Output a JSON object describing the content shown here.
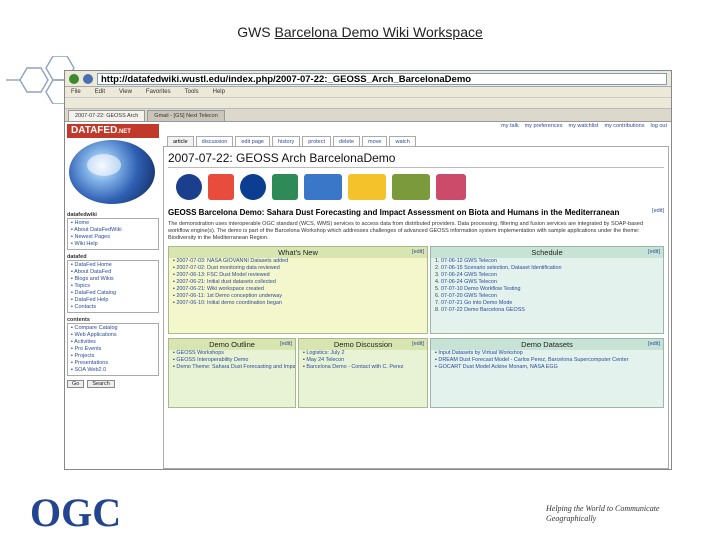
{
  "slide": {
    "title_prefix": "GWS ",
    "title_link": "Barcelona Demo Wiki Workspace",
    "footer_tag_line1": "Helping the World to Communicate",
    "footer_tag_line2": "Geographically",
    "logo_text": "OGC"
  },
  "browser": {
    "url": "http://datafedwiki.wustl.edu/index.php/2007-07-22:_GEOSS_Arch_BarcelonaDemo",
    "tab_active": "2007-07-22: GEOSS Arch",
    "tab_other": "Gmail - [GS] Next Telecon"
  },
  "site": {
    "logo": "DATAFED",
    "logo_suffix": ".NET",
    "page_tabs": [
      "article",
      "discussion",
      "edit page",
      "history",
      "protect",
      "delete",
      "move",
      "watch"
    ],
    "user_links": [
      "my talk",
      "my preferences",
      "my watchlist",
      "my contributions",
      "log out"
    ],
    "page_title": "2007-07-22: GEOSS Arch BarcelonaDemo",
    "heading": "GEOSS Barcelona Demo: Sahara Dust Forecasting and Impact Assessment on Biota and Humans in the Mediterranean",
    "edit_label": "[edit]",
    "description": "The demonstration uses interoperable OGC standard (WCS, WMS) services to access data from distributed providers. Data processing, filtering and fusion services are integrated by SOAP-based workflow engine(s). The demo is part of the Barcelona Workshop which addresses challenges of advanced GEOSS information system implementation with sample applications under the theme: Biodiversity in the Mediterranean Region.",
    "sidebar": {
      "sections": [
        {
          "title": "datafedwiki",
          "items": [
            "Home",
            "About DataFedWiki",
            "Newest Pages",
            "Wiki Help"
          ]
        },
        {
          "title": "datafed",
          "items": [
            "DataFed Home",
            "About DataFed",
            "Blogs and Wikis",
            "Topics",
            "DataFed Catalog",
            "DataFed Help",
            "Contacts"
          ]
        },
        {
          "title": "contents",
          "items": [
            "Compare Catalog",
            "Web Applications",
            "Activities",
            "Pro Events",
            "Projects",
            "Presentations",
            "SOA Web2.0"
          ]
        }
      ],
      "search_go": "Go",
      "search_btn": "Search"
    },
    "whats_new": {
      "title": "What's New",
      "items": [
        "2007-07-03: NASA GIOVANNI Datasets added",
        "2007-07-02: Dust monitoring data reviewed",
        "2007-06-13: FSC Dust Model reviewed",
        "2007-06-21: Initial dust datasets collected",
        "2007-06-21: Wiki workspace created",
        "2007-06-11: 1st Demo conception underway",
        "2007-06-10: Initial demo coordination began"
      ]
    },
    "schedule": {
      "title": "Schedule",
      "items": [
        "07-06-12 GWS Telecon",
        "07-06-15 Scenario selection, Dataset Identification",
        "07-06-24 GWS Telecon",
        "07-06-24 GWS Telecon",
        "07-07-10 Demo Workflow Testing",
        "07-07-20 GWS Telecon",
        "07-07-21 Go into Demo Mode",
        "07-07-22 Demo Barcelona GEOSS"
      ]
    },
    "demo_outline": {
      "title": "Demo Outline",
      "items": [
        "GEOSS Workshops",
        "GEOSS Interoperability Demo",
        "Demo Theme: Sahara Dust Forecasting and Impact Assessment"
      ]
    },
    "demo_discussion": {
      "title": "Demo Discussion",
      "items": [
        "Logistics: July 2",
        "May 24 Telecon",
        "Barcelona Demo - Contact with C. Perez"
      ]
    },
    "demo_datasets": {
      "title": "Demo Datasets",
      "items": [
        "Input Datasets by Virtual Workshop",
        "DREAM Dust Forecast Model - Carlos Perez, Barcelona Supercomputer Center",
        "GOCART Dust Model Ackine Monam, NASA EGG"
      ]
    }
  }
}
